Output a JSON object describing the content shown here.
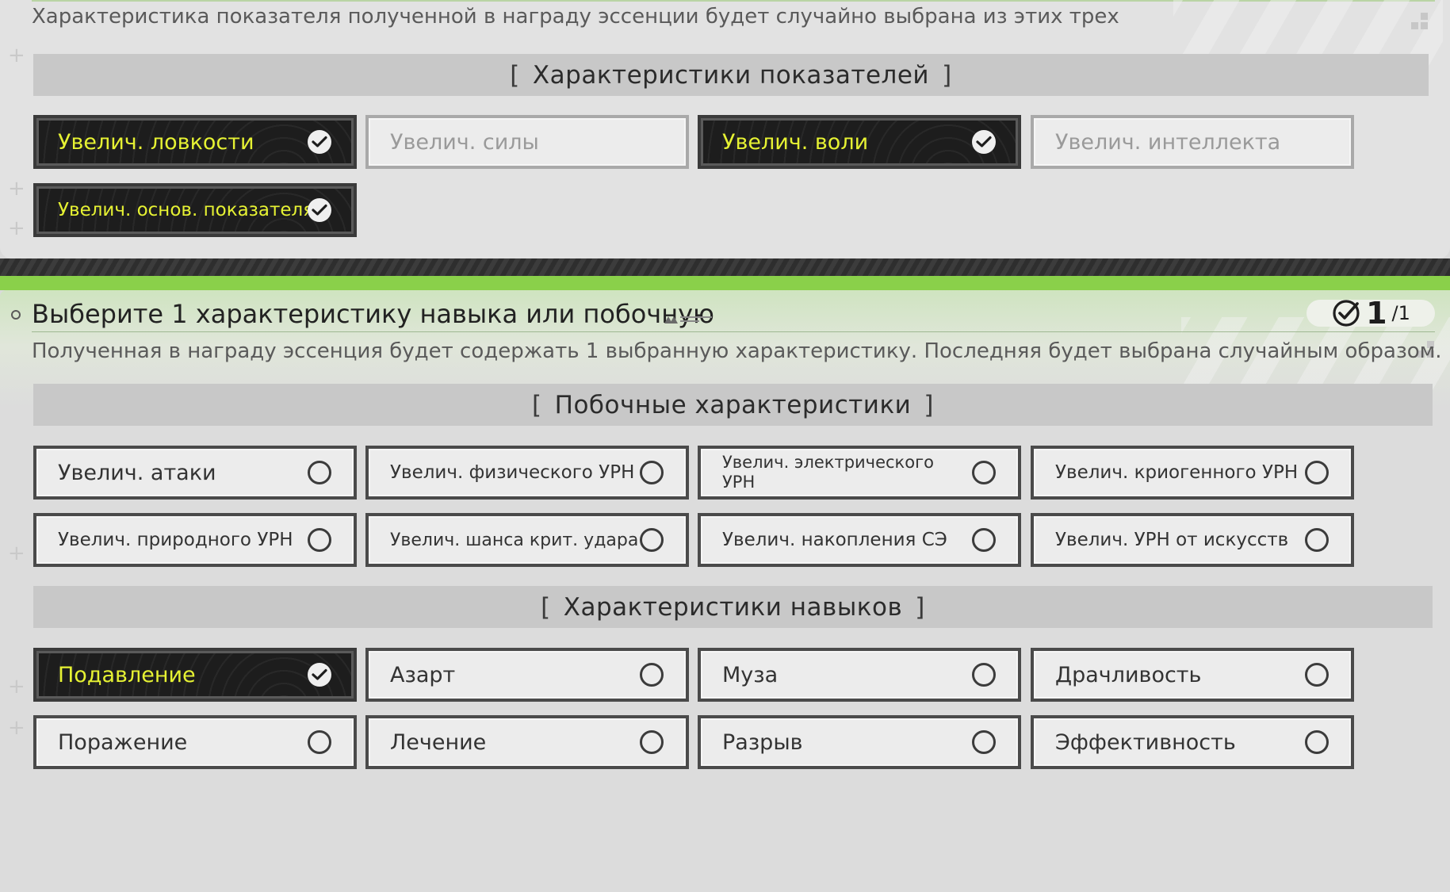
{
  "top_section": {
    "description": "Характеристика показателя полученной в награду эссенции будет случайно выбрана из этих трех",
    "header": {
      "open": "[",
      "label": "Характеристики показателей",
      "close": "]"
    },
    "options": [
      {
        "label": "Увелич. ловкости",
        "selected": true
      },
      {
        "label": "Увелич. силы",
        "selected": false
      },
      {
        "label": "Увелич. воли",
        "selected": true
      },
      {
        "label": "Увелич. интеллекта",
        "selected": false
      },
      {
        "label": "Увелич. основ. показателя",
        "selected": true
      }
    ]
  },
  "bottom_section": {
    "title": "Выберите 1 характеристику навыка или побочную",
    "counter": {
      "current": "1",
      "total": "/1"
    },
    "description": "Полученная в награду эссенция будет содержать 1 выбранную характеристику. Последняя будет выбрана случайным образом.",
    "secondary_header": {
      "open": "[",
      "label": "Побочные характеристики",
      "close": "]"
    },
    "secondary_options": [
      {
        "label": "Увелич. атаки",
        "selected": false
      },
      {
        "label": "Увелич. физического УРН",
        "selected": false
      },
      {
        "label": "Увелич. электрического УРН",
        "selected": false
      },
      {
        "label": "Увелич. криогенного УРН",
        "selected": false
      },
      {
        "label": "Увелич. природного УРН",
        "selected": false
      },
      {
        "label": "Увелич. шанса крит. удара",
        "selected": false
      },
      {
        "label": "Увелич. накопления СЭ",
        "selected": false
      },
      {
        "label": "Увелич. УРН от искусств",
        "selected": false
      }
    ],
    "skill_header": {
      "open": "[",
      "label": "Характеристики навыков",
      "close": "]"
    },
    "skill_options": [
      {
        "label": "Подавление",
        "selected": true
      },
      {
        "label": "Азарт",
        "selected": false
      },
      {
        "label": "Муза",
        "selected": false
      },
      {
        "label": "Драчливость",
        "selected": false
      },
      {
        "label": "Поражение",
        "selected": false
      },
      {
        "label": "Лечение",
        "selected": false
      },
      {
        "label": "Разрыв",
        "selected": false
      },
      {
        "label": "Эффективность",
        "selected": false
      }
    ]
  },
  "colors": {
    "selected_text": "#e6f233",
    "selected_bg": "#1d1d1d",
    "accent_green": "#8ad04a"
  }
}
